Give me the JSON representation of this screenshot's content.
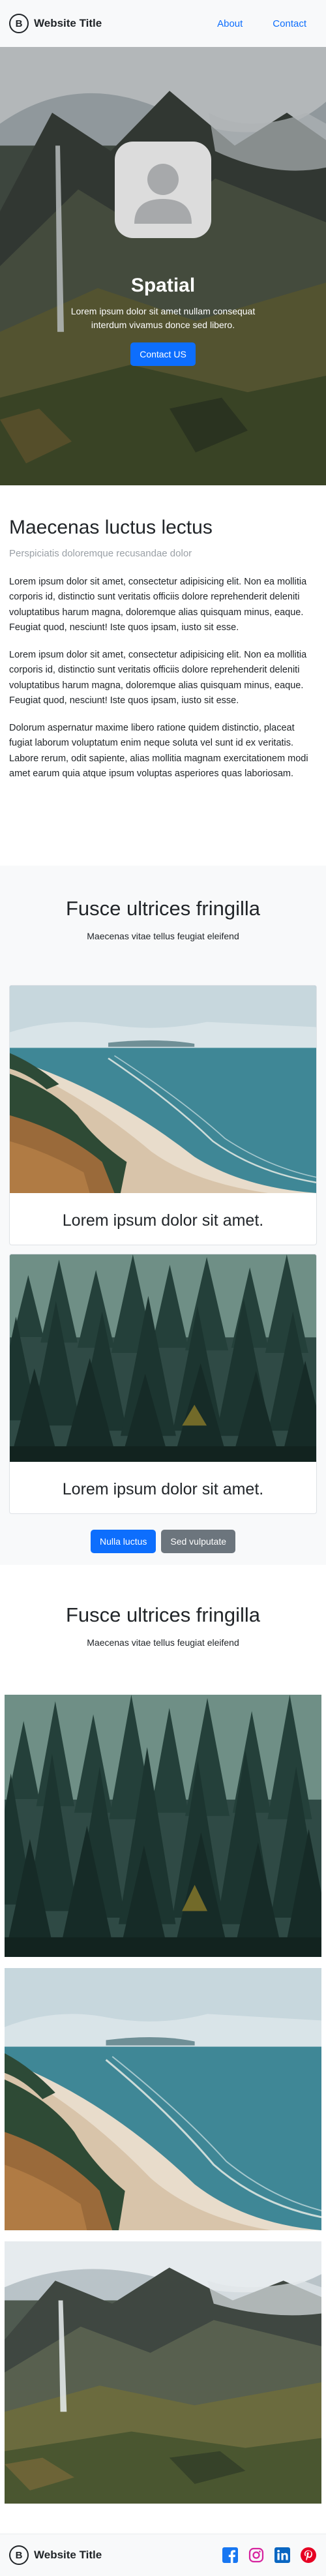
{
  "nav": {
    "brand_logo_letter": "B",
    "brand_title": "Website Title",
    "links": [
      {
        "label": "About"
      },
      {
        "label": "Contact"
      }
    ]
  },
  "hero": {
    "title": "Spatial",
    "subtitle": "Lorem ipsum dolor sit amet nullam consequat interdum vivamus donce sed libero.",
    "cta_label": "Contact US"
  },
  "about": {
    "heading": "Maecenas luctus lectus",
    "subheading": "Perspiciatis doloremque recusandae dolor",
    "paragraphs": [
      "Lorem ipsum dolor sit amet, consectetur adipisicing elit. Non ea mollitia corporis id, distinctio sunt veritatis officiis dolore reprehenderit deleniti voluptatibus harum magna, doloremque alias quisquam minus, eaque. Feugiat quod, nesciunt! Iste quos ipsam, iusto sit esse.",
      "Lorem ipsum dolor sit amet, consectetur adipisicing elit. Non ea mollitia corporis id, distinctio sunt veritatis officiis dolore reprehenderit deleniti voluptatibus harum magna, doloremque alias quisquam minus, eaque. Feugiat quod, nesciunt! Iste quos ipsam, iusto sit esse.",
      "Dolorum aspernatur maxime libero ratione quidem distinctio, placeat fugiat laborum voluptatum enim neque soluta vel sunt id ex veritatis. Labore rerum, odit sapiente, alias mollitia magnam exercitationem modi amet earum quia atque ipsum voluptas asperiores quas laboriosam."
    ]
  },
  "cards_section": {
    "title": "Fusce ultrices fringilla",
    "subtitle": "Maecenas vitae tellus feugiat eleifend",
    "cards": [
      {
        "caption": "Lorem ipsum dolor sit amet."
      },
      {
        "caption": "Lorem ipsum dolor sit amet."
      }
    ],
    "buttons": [
      {
        "label": "Nulla luctus"
      },
      {
        "label": "Sed vulputate"
      }
    ]
  },
  "gallery_section": {
    "title": "Fusce ultrices fringilla",
    "subtitle": "Maecenas vitae tellus feugiat eleifend"
  },
  "footer": {
    "brand_logo_letter": "B",
    "brand_title": "Website Title",
    "social_icons": [
      "facebook-icon",
      "instagram-icon",
      "linkedin-icon",
      "pinterest-icon"
    ]
  },
  "colors": {
    "primary": "#0d6efd",
    "secondary": "#6c757d",
    "light_bg": "#f8f9fa",
    "muted_text": "#9aa0a6"
  }
}
